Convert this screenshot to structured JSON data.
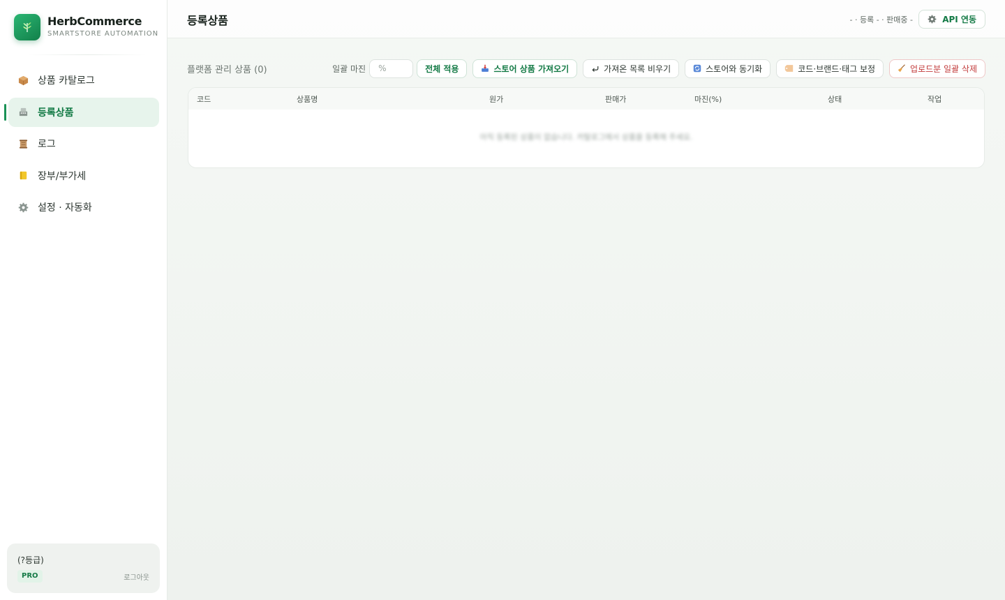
{
  "brand": {
    "name": "HerbCommerce",
    "subtitle": "SMARTSTORE AUTOMATION"
  },
  "sidebar": {
    "items": [
      {
        "label": "상품 카탈로그",
        "icon": "package-icon",
        "active": false
      },
      {
        "label": "등록상품",
        "icon": "register-icon",
        "active": true
      },
      {
        "label": "로그",
        "icon": "scroll-icon",
        "active": false
      },
      {
        "label": "장부/부가세",
        "icon": "ledger-icon",
        "active": false
      },
      {
        "label": "설정 · 자동화",
        "icon": "gear-icon",
        "active": false
      }
    ]
  },
  "user": {
    "grade": "(?등급)",
    "plan": "PRO",
    "logout_label": "로그아웃"
  },
  "header": {
    "title": "등록상품",
    "status": "- · 등록 - · 판매중 -",
    "api_button": "API 연동"
  },
  "toolbar": {
    "section_label": "플랫폼 관리 상품 (0)",
    "margin_label": "일괄 마진",
    "margin_placeholder": "%",
    "apply_all": "전체 적용",
    "import_store": "스토어 상품 가져오기",
    "clear_imported": "가져온 목록 비우기",
    "sync_store": "스토어와 동기화",
    "fix_code_brand_tag": "코드·브랜드·태그 보정",
    "delete_uploaded": "업로드분 일괄 삭제"
  },
  "table": {
    "columns": [
      "코드",
      "상품명",
      "원가",
      "판매가",
      "마진(%)",
      "상태",
      "작업"
    ],
    "empty_text": "아직 등록된 상품이 없습니다. 카탈로그에서 상품을 등록해 주세요."
  },
  "colors": {
    "accent": "#137a45",
    "active_bg": "#e7f4ec",
    "danger": "#c23b3b"
  }
}
